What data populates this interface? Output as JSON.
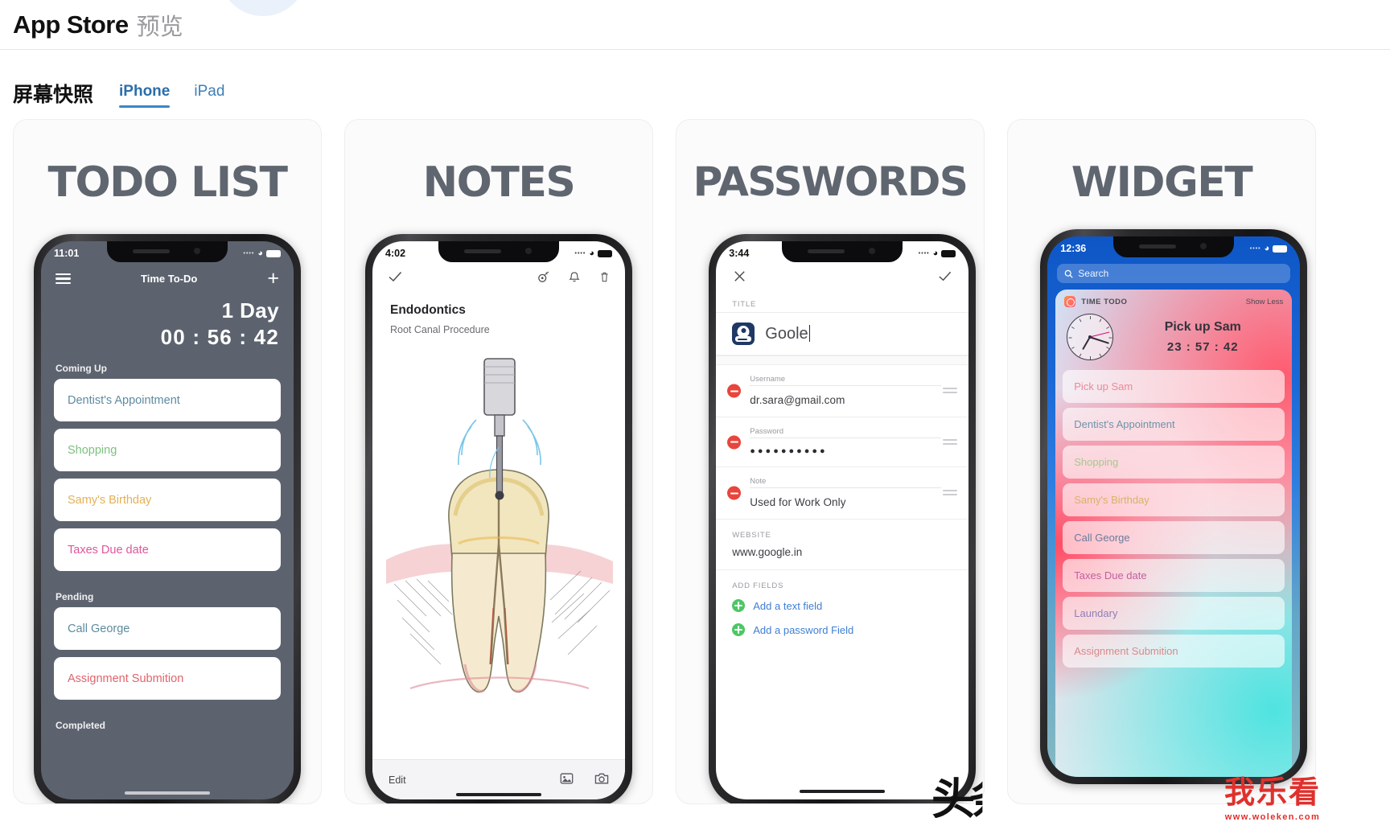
{
  "header": {
    "title": "App Store",
    "subtitle": "预览"
  },
  "tabs_section": {
    "label": "屏幕快照",
    "tabs": [
      {
        "label": "iPhone",
        "active": true
      },
      {
        "label": "iPad",
        "active": false
      }
    ]
  },
  "cards": [
    {
      "title": "TODO LIST",
      "phone": {
        "status": {
          "time": "11:01",
          "wifi": "wifi-icon",
          "battery": "battery-icon"
        },
        "nav": {
          "menu_icon": "hamburger-icon",
          "title": "Time To-Do",
          "add_icon": "plus-icon"
        },
        "timer": {
          "days": "1 Day",
          "clock": "00 : 56 : 42"
        },
        "sections": [
          {
            "label": "Coming Up",
            "items": [
              {
                "label": "Dentist's Appointment",
                "color": "#5d8ba0"
              },
              {
                "label": "Shopping",
                "color": "#7cc17e"
              },
              {
                "label": "Samy's Birthday",
                "color": "#e5b057"
              },
              {
                "label": "Taxes Due date",
                "color": "#e0559c"
              }
            ]
          },
          {
            "label": "Pending",
            "items": [
              {
                "label": "Call George",
                "color": "#5d8ba0"
              },
              {
                "label": "Assignment Submition",
                "color": "#e0646e"
              }
            ]
          },
          {
            "label": "Completed",
            "items": []
          }
        ]
      }
    },
    {
      "title": "NOTES",
      "phone": {
        "status": {
          "time": "4:02",
          "wifi": "wifi-icon",
          "battery": "battery-icon"
        },
        "nav": {
          "done_icon": "check-icon",
          "record_icon": "voice-record-icon",
          "bell_icon": "bell-icon",
          "trash_icon": "trash-icon"
        },
        "note": {
          "title": "Endodontics",
          "subtitle": "Root Canal Procedure",
          "drawing": "tooth-root-canal-sketch"
        },
        "bottom": {
          "edit_label": "Edit",
          "gallery_icon": "photo-icon",
          "camera_icon": "camera-icon"
        }
      }
    },
    {
      "title": "PASSWORDS",
      "phone": {
        "status": {
          "time": "3:44",
          "wifi": "wifi-icon",
          "battery": "battery-icon"
        },
        "nav": {
          "close_icon": "close-icon",
          "save_icon": "check-icon"
        },
        "title_section": {
          "label": "TITLE",
          "icon": "password-app-icon",
          "value": "Goole"
        },
        "fields": [
          {
            "label": "Username",
            "value": "dr.sara@gmail.com",
            "remove_icon": "minus-circle-icon",
            "drag_icon": "drag-handle-icon"
          },
          {
            "label": "Password",
            "value": "●●●●●●●●●●",
            "remove_icon": "minus-circle-icon",
            "drag_icon": "drag-handle-icon"
          },
          {
            "label": "Note",
            "value": "Used for Work Only",
            "remove_icon": "minus-circle-icon",
            "drag_icon": "drag-handle-icon"
          }
        ],
        "website": {
          "label": "WEBSITE",
          "value": "www.google.in"
        },
        "add_fields": {
          "label": "ADD FIELDS",
          "actions": [
            {
              "label": "Add a text field",
              "icon": "plus-circle-icon"
            },
            {
              "label": "Add a password Field",
              "icon": "plus-circle-icon"
            }
          ]
        }
      }
    },
    {
      "title": "WIDGET",
      "phone": {
        "status": {
          "time": "12:36",
          "wifi": "wifi-icon",
          "battery": "battery-icon"
        },
        "search": {
          "placeholder": "Search",
          "icon": "search-icon"
        },
        "widget": {
          "app_name": "TIME TODO",
          "app_icon": "time-todo-icon",
          "show_less": "Show Less",
          "clock_icon": "analog-clock-icon",
          "headline": "Pick up Sam",
          "countdown": "23 : 57 : 42",
          "items": [
            {
              "label": "Pick up Sam",
              "color": "#e88a98"
            },
            {
              "label": "Dentist's Appointment",
              "color": "#6e93a8"
            },
            {
              "label": "Shopping",
              "color": "#a7c98d"
            },
            {
              "label": "Samy's Birthday",
              "color": "#d8b26a"
            },
            {
              "label": "Call George",
              "color": "#6b7a9e"
            },
            {
              "label": "Taxes Due date",
              "color": "#c35fa0"
            },
            {
              "label": "Laundary",
              "color": "#8f7fb5"
            },
            {
              "label": "Assignment Submition",
              "color": "#d98a8a"
            }
          ]
        }
      }
    }
  ],
  "watermarks": {
    "toutiao": "头条",
    "site_name": "我乐看",
    "site_url": "www.woleken.com"
  }
}
